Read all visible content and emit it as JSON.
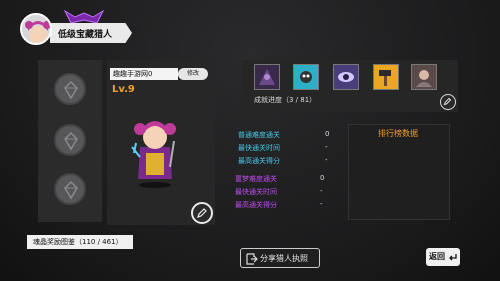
{
  "header": {
    "title": "低级宝藏猎人"
  },
  "character": {
    "name": "趣趣手游网0",
    "rename_label": "修改",
    "level": "Lv.9"
  },
  "achievements": {
    "progress_label": "成就进度（3 / 81）",
    "icons": [
      "portrait-dark-icon",
      "spider-monster-icon",
      "eye-monster-icon",
      "hammer-icon",
      "portrait-hero-icon"
    ],
    "colors": [
      "#4a3a5a",
      "#2bb0c8",
      "#5a4e8a",
      "#e8a822",
      "#6a5a5a"
    ]
  },
  "stats": {
    "normal": [
      {
        "label": "普通难度通关",
        "value": "0"
      },
      {
        "label": "最快通关时间",
        "value": "-"
      },
      {
        "label": "最高通关得分",
        "value": "-"
      }
    ],
    "nightmare": [
      {
        "label": "噩梦难度通关",
        "value": "0"
      },
      {
        "label": "最快通关时间",
        "value": "-"
      },
      {
        "label": "最高通关得分",
        "value": "-"
      }
    ],
    "normal_color": "#4cc7e8",
    "nightmare_color": "#c04cf0"
  },
  "ranking": {
    "title": "排行榜数据"
  },
  "footer": {
    "crystal_label": "魂晶奖励图鉴（110 / 461）",
    "share_label": "分享猎人执照",
    "back_label": "返回"
  }
}
